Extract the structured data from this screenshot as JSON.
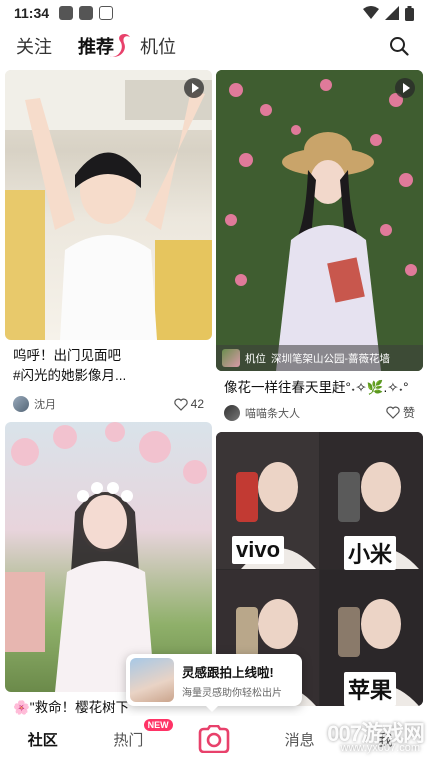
{
  "status_bar": {
    "time": "11:34"
  },
  "top_nav": {
    "tabs": [
      {
        "label": "关注"
      },
      {
        "label": "推荐"
      },
      {
        "label": "机位"
      }
    ]
  },
  "feed": {
    "cards": [
      {
        "title_line1": "呜呼！出门见面吧",
        "title_line2": "#闪光的她影像月...",
        "author": "沈月",
        "likes": "42"
      },
      {
        "location_prefix": "机位",
        "location": "深圳笔架山公园-蔷薇花墙",
        "title": "像花一样往春天里赶°˖✧🌿.✧˖°",
        "author": "喵喵条大人",
        "likes": "赞"
      },
      {
        "title": "🌸\"救命！樱花树下"
      },
      {
        "labels": [
          "vivo",
          "小米",
          "苹果"
        ],
        "title": ""
      }
    ]
  },
  "popup": {
    "title": "灵感跟拍上线啦!",
    "subtitle": "海量灵感助你轻松出片"
  },
  "bottom_nav": {
    "items": [
      {
        "label": "社区"
      },
      {
        "label": "热门",
        "badge": "NEW"
      },
      {
        "label": ""
      },
      {
        "label": "消息"
      },
      {
        "label": "我"
      }
    ]
  },
  "watermark": {
    "big": "007游戏网",
    "small": "www.yx007.com"
  },
  "colors": {
    "accent": "#ff3366",
    "brand_pink": "#e8416b"
  }
}
